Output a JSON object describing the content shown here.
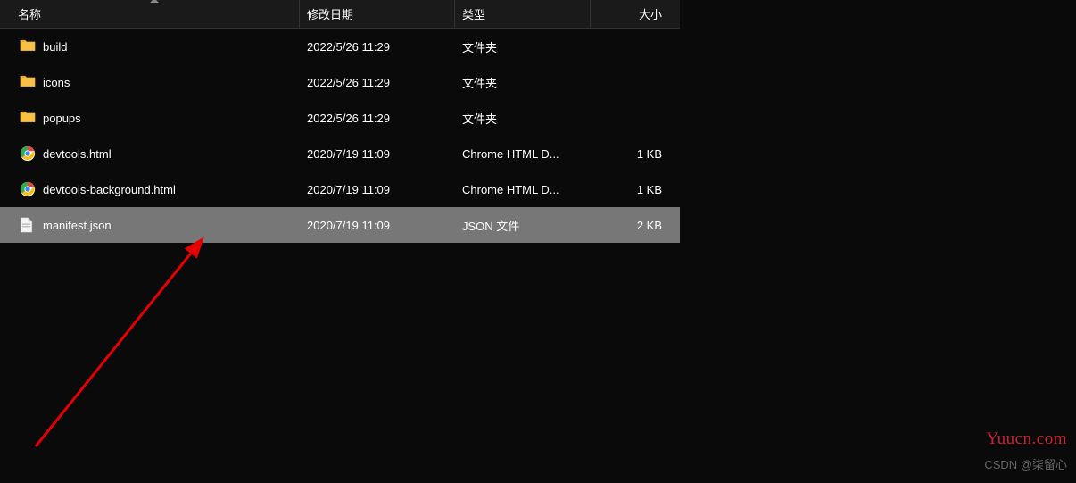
{
  "headers": {
    "name": "名称",
    "date": "修改日期",
    "type": "类型",
    "size": "大小"
  },
  "rows": [
    {
      "icon": "folder",
      "name": "build",
      "date": "2022/5/26 11:29",
      "type": "文件夹",
      "size": "",
      "selected": false
    },
    {
      "icon": "folder",
      "name": "icons",
      "date": "2022/5/26 11:29",
      "type": "文件夹",
      "size": "",
      "selected": false
    },
    {
      "icon": "folder",
      "name": "popups",
      "date": "2022/5/26 11:29",
      "type": "文件夹",
      "size": "",
      "selected": false
    },
    {
      "icon": "chrome",
      "name": "devtools.html",
      "date": "2020/7/19 11:09",
      "type": "Chrome HTML D...",
      "size": "1 KB",
      "selected": false
    },
    {
      "icon": "chrome",
      "name": "devtools-background.html",
      "date": "2020/7/19 11:09",
      "type": "Chrome HTML D...",
      "size": "1 KB",
      "selected": false
    },
    {
      "icon": "file",
      "name": "manifest.json",
      "date": "2020/7/19 11:09",
      "type": "JSON 文件",
      "size": "2 KB",
      "selected": true
    }
  ],
  "watermark1": "Yuucn.com",
  "watermark2": "CSDN @柒留心"
}
